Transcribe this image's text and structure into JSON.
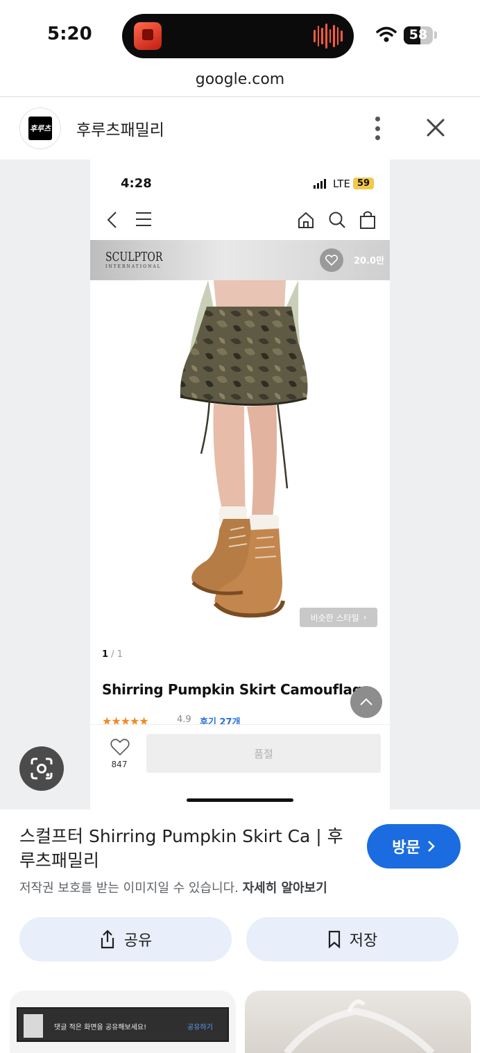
{
  "status_bar": {
    "time": "5:20",
    "battery": "58",
    "battery_level": 0.58
  },
  "browser": {
    "url": "google.com"
  },
  "site": {
    "logo_text": "후루츠",
    "name": "후루츠패밀리"
  },
  "preview": {
    "phone_status": {
      "time": "4:28",
      "network": "LTE",
      "battery": "59"
    },
    "banner": {
      "brand": "SCULPTOR",
      "brand_sub": "INTERNATIONAL",
      "like_count": "20.0만"
    },
    "similar_style_label": "비슷한 스타일",
    "pager": {
      "current": "1",
      "total": "1"
    },
    "product_title": "Shirring Pumpkin Skirt Camouflage",
    "rating": {
      "stars": "★★★★★",
      "score": "4.9",
      "reviews": "후기 27개",
      "value": 4.9
    },
    "likes": "847",
    "soldout_label": "품절"
  },
  "result": {
    "title": "스컬프터 Shirring Pumpkin Skirt Ca | 후루츠패밀리",
    "copyright_text": "저작권 보호를 받는 이미지일 수 있습니다.",
    "learn_more": "자세히 알아보기",
    "visit_label": "방문"
  },
  "actions": {
    "share_label": "공유",
    "save_label": "저장"
  },
  "related": {
    "thumb1_text": "댓글 적은 화면을 공유해보세요!",
    "thumb1_link": "공유하기"
  },
  "colors": {
    "visit_button": "#1a6ce0",
    "action_button_bg": "#e8eefa",
    "star": "#f08a24",
    "link": "#2a6fdb"
  }
}
